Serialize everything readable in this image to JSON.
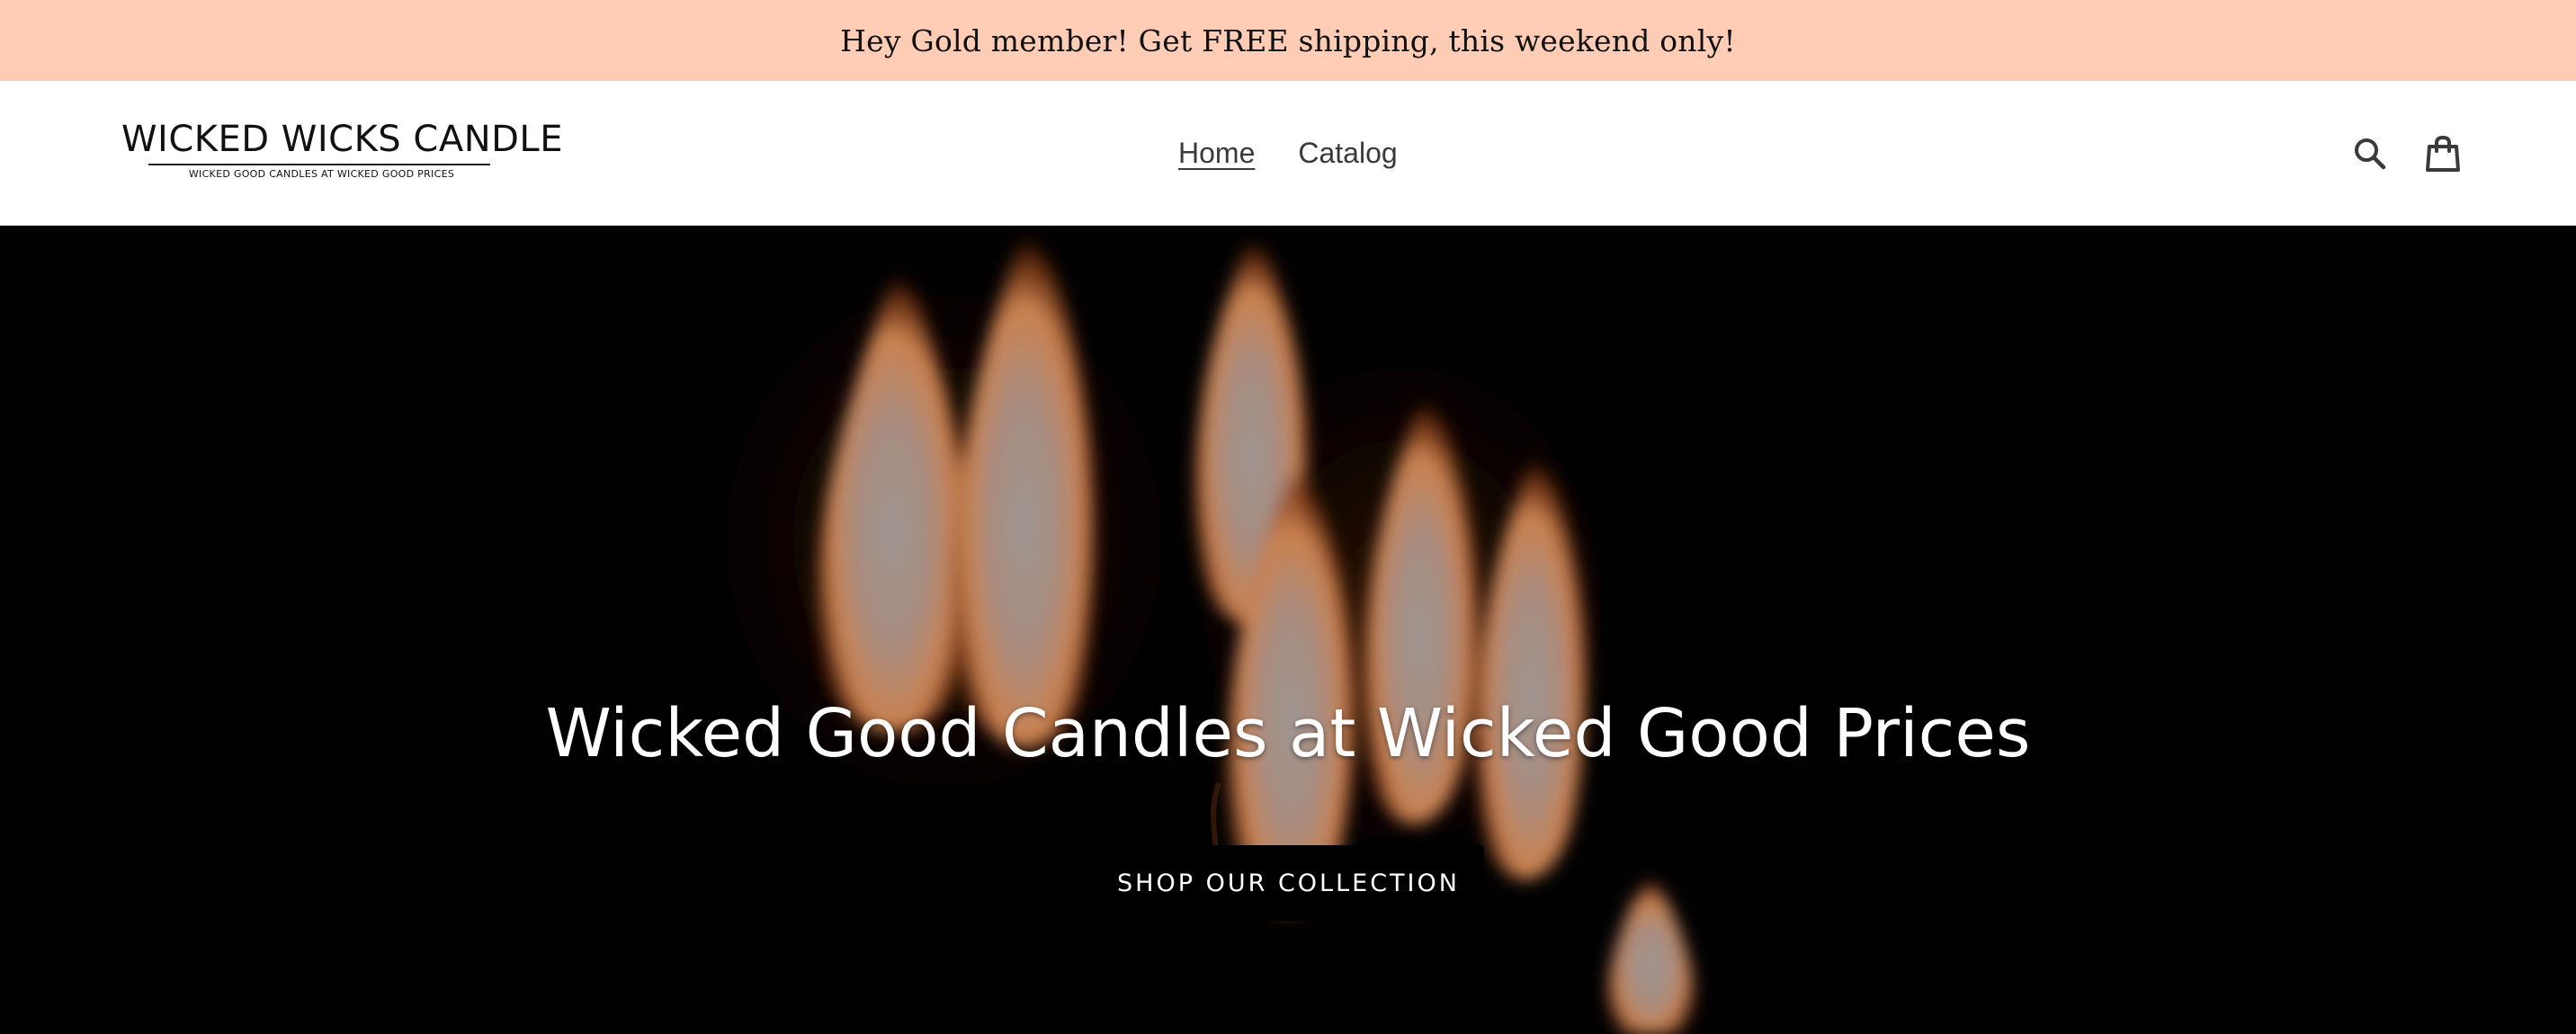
{
  "announcement": {
    "text": "Hey Gold member! Get FREE shipping, this weekend only!",
    "background": "#ffcdb5"
  },
  "header": {
    "logo": {
      "title": "WICKED WICKS CANDLE",
      "tagline": "WICKED GOOD CANDLES AT WICKED GOOD PRICES"
    },
    "nav": [
      {
        "label": "Home",
        "active": true
      },
      {
        "label": "Catalog",
        "active": false
      }
    ],
    "icons": {
      "search": "search-icon",
      "cart": "cart-icon"
    }
  },
  "hero": {
    "heading": "Wicked Good Candles at Wicked Good Prices",
    "button_label": "SHOP OUR COLLECTION",
    "background": "candle flames on black",
    "flame_color": "#f0a070"
  }
}
